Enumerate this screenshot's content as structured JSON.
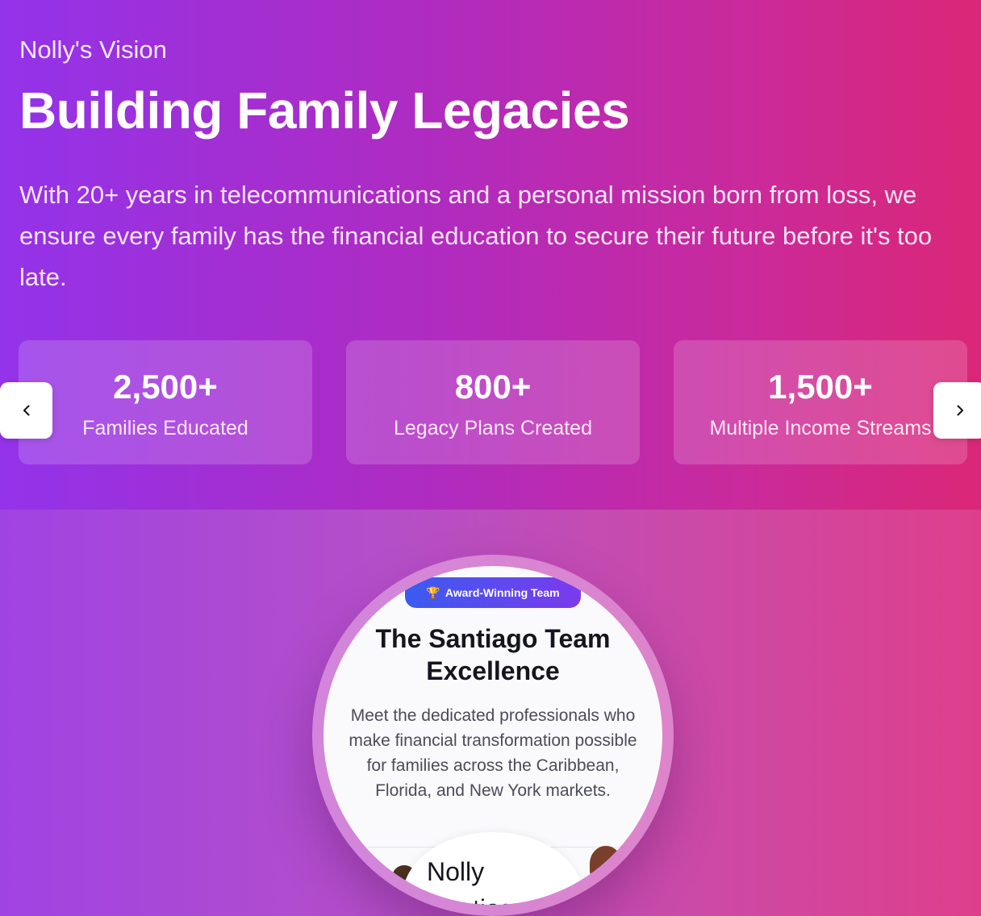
{
  "hero": {
    "eyebrow": "Nolly's Vision",
    "title": "Building Family Legacies",
    "lede": "With 20+ years in telecommunications and a personal mission born from loss, we ensure every family has the financial education to secure their future before it's too late.",
    "stats": [
      {
        "value": "2,500+",
        "label": "Families Educated"
      },
      {
        "value": "800+",
        "label": "Legacy Plans Created"
      },
      {
        "value": "1,500+",
        "label": "Multiple Income Streams"
      }
    ]
  },
  "carousel": {
    "prev_icon": "chevron-left-icon",
    "next_icon": "chevron-right-icon"
  },
  "team": {
    "badge_icon": "trophy-icon",
    "badge_label": "Award-Winning Team",
    "title": "The Santiago Team Excellence",
    "description": "Meet the dedicated professionals who make financial transformation possible for families across the Caribbean, Florida, and New York markets.",
    "member_name": "Nolly Santiago"
  },
  "colors": {
    "hero_gradient_start": "#9333ea",
    "hero_gradient_end": "#db2777",
    "badge_gradient_start": "#3b5bf0",
    "badge_gradient_end": "#7c3aed"
  }
}
